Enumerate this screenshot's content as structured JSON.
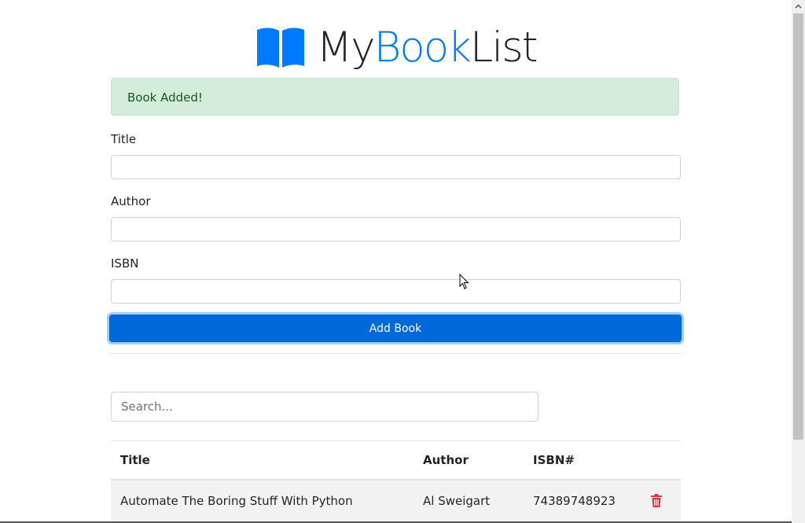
{
  "brand": {
    "my": "My",
    "book": "Book",
    "list": "List",
    "icon": "open-book-icon",
    "accent_color": "#007bff"
  },
  "alert": {
    "message": "Book Added!",
    "color": "#d4edda"
  },
  "form": {
    "title_label": "Title",
    "title_value": "",
    "author_label": "Author",
    "author_value": "",
    "isbn_label": "ISBN",
    "isbn_value": "",
    "submit_label": "Add Book",
    "submit_color": "#0069d9"
  },
  "search": {
    "placeholder": "Search...",
    "value": ""
  },
  "table": {
    "columns": [
      "Title",
      "Author",
      "ISBN#"
    ],
    "rows": [
      {
        "title": "Automate The Boring Stuff With Python",
        "author": "Al Sweigart",
        "isbn": "74389748923",
        "action_icon": "trash-icon"
      }
    ],
    "delete_color": "#dc3545"
  }
}
